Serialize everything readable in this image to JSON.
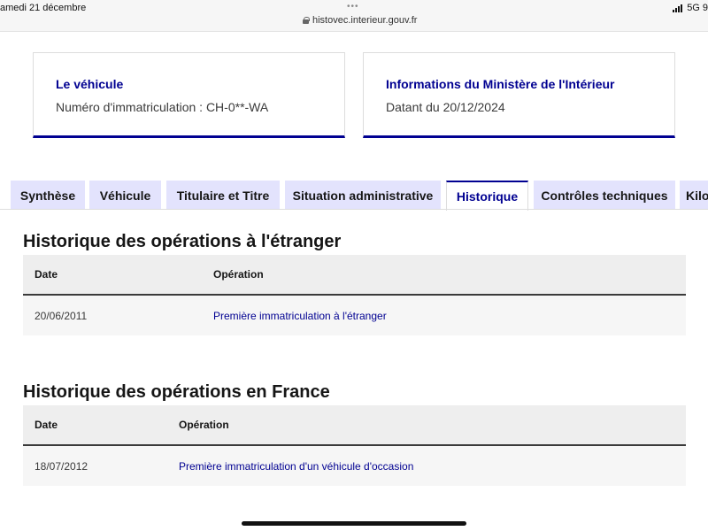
{
  "statusbar": {
    "date": "amedi 21 décembre",
    "dots": "•••",
    "url": "histovec.interieur.gouv.fr",
    "network": "5G",
    "battery_fragment": "9"
  },
  "cards": [
    {
      "title": "Le véhicule",
      "text": "Numéro d'immatriculation : CH-0**-WA"
    },
    {
      "title": "Informations du Ministère de l'Intérieur",
      "text": "Datant du 20/12/2024"
    }
  ],
  "tabs": [
    {
      "label": "Synthèse",
      "active": false
    },
    {
      "label": "Véhicule",
      "active": false
    },
    {
      "label": "Titulaire et Titre",
      "active": false
    },
    {
      "label": "Situation administrative",
      "active": false
    },
    {
      "label": "Historique",
      "active": true
    },
    {
      "label": "Contrôles techniques",
      "active": false
    },
    {
      "label": "Kilo",
      "active": false
    }
  ],
  "sections": [
    {
      "title": "Historique des opérations à l'étranger",
      "columns": [
        "Date",
        "Opération"
      ],
      "rows": [
        {
          "date": "20/06/2011",
          "operation": "Première immatriculation à l'étranger"
        }
      ]
    },
    {
      "title": "Historique des opérations en France",
      "columns": [
        "Date",
        "Opération"
      ],
      "rows": [
        {
          "date": "18/07/2012",
          "operation": "Première immatriculation d'un véhicule d'occasion"
        }
      ]
    }
  ],
  "colors": {
    "accent": "#000091",
    "tab_bg": "#e3e3fd",
    "table_header_bg": "#eeeeee",
    "table_row_bg": "#f6f6f6"
  }
}
